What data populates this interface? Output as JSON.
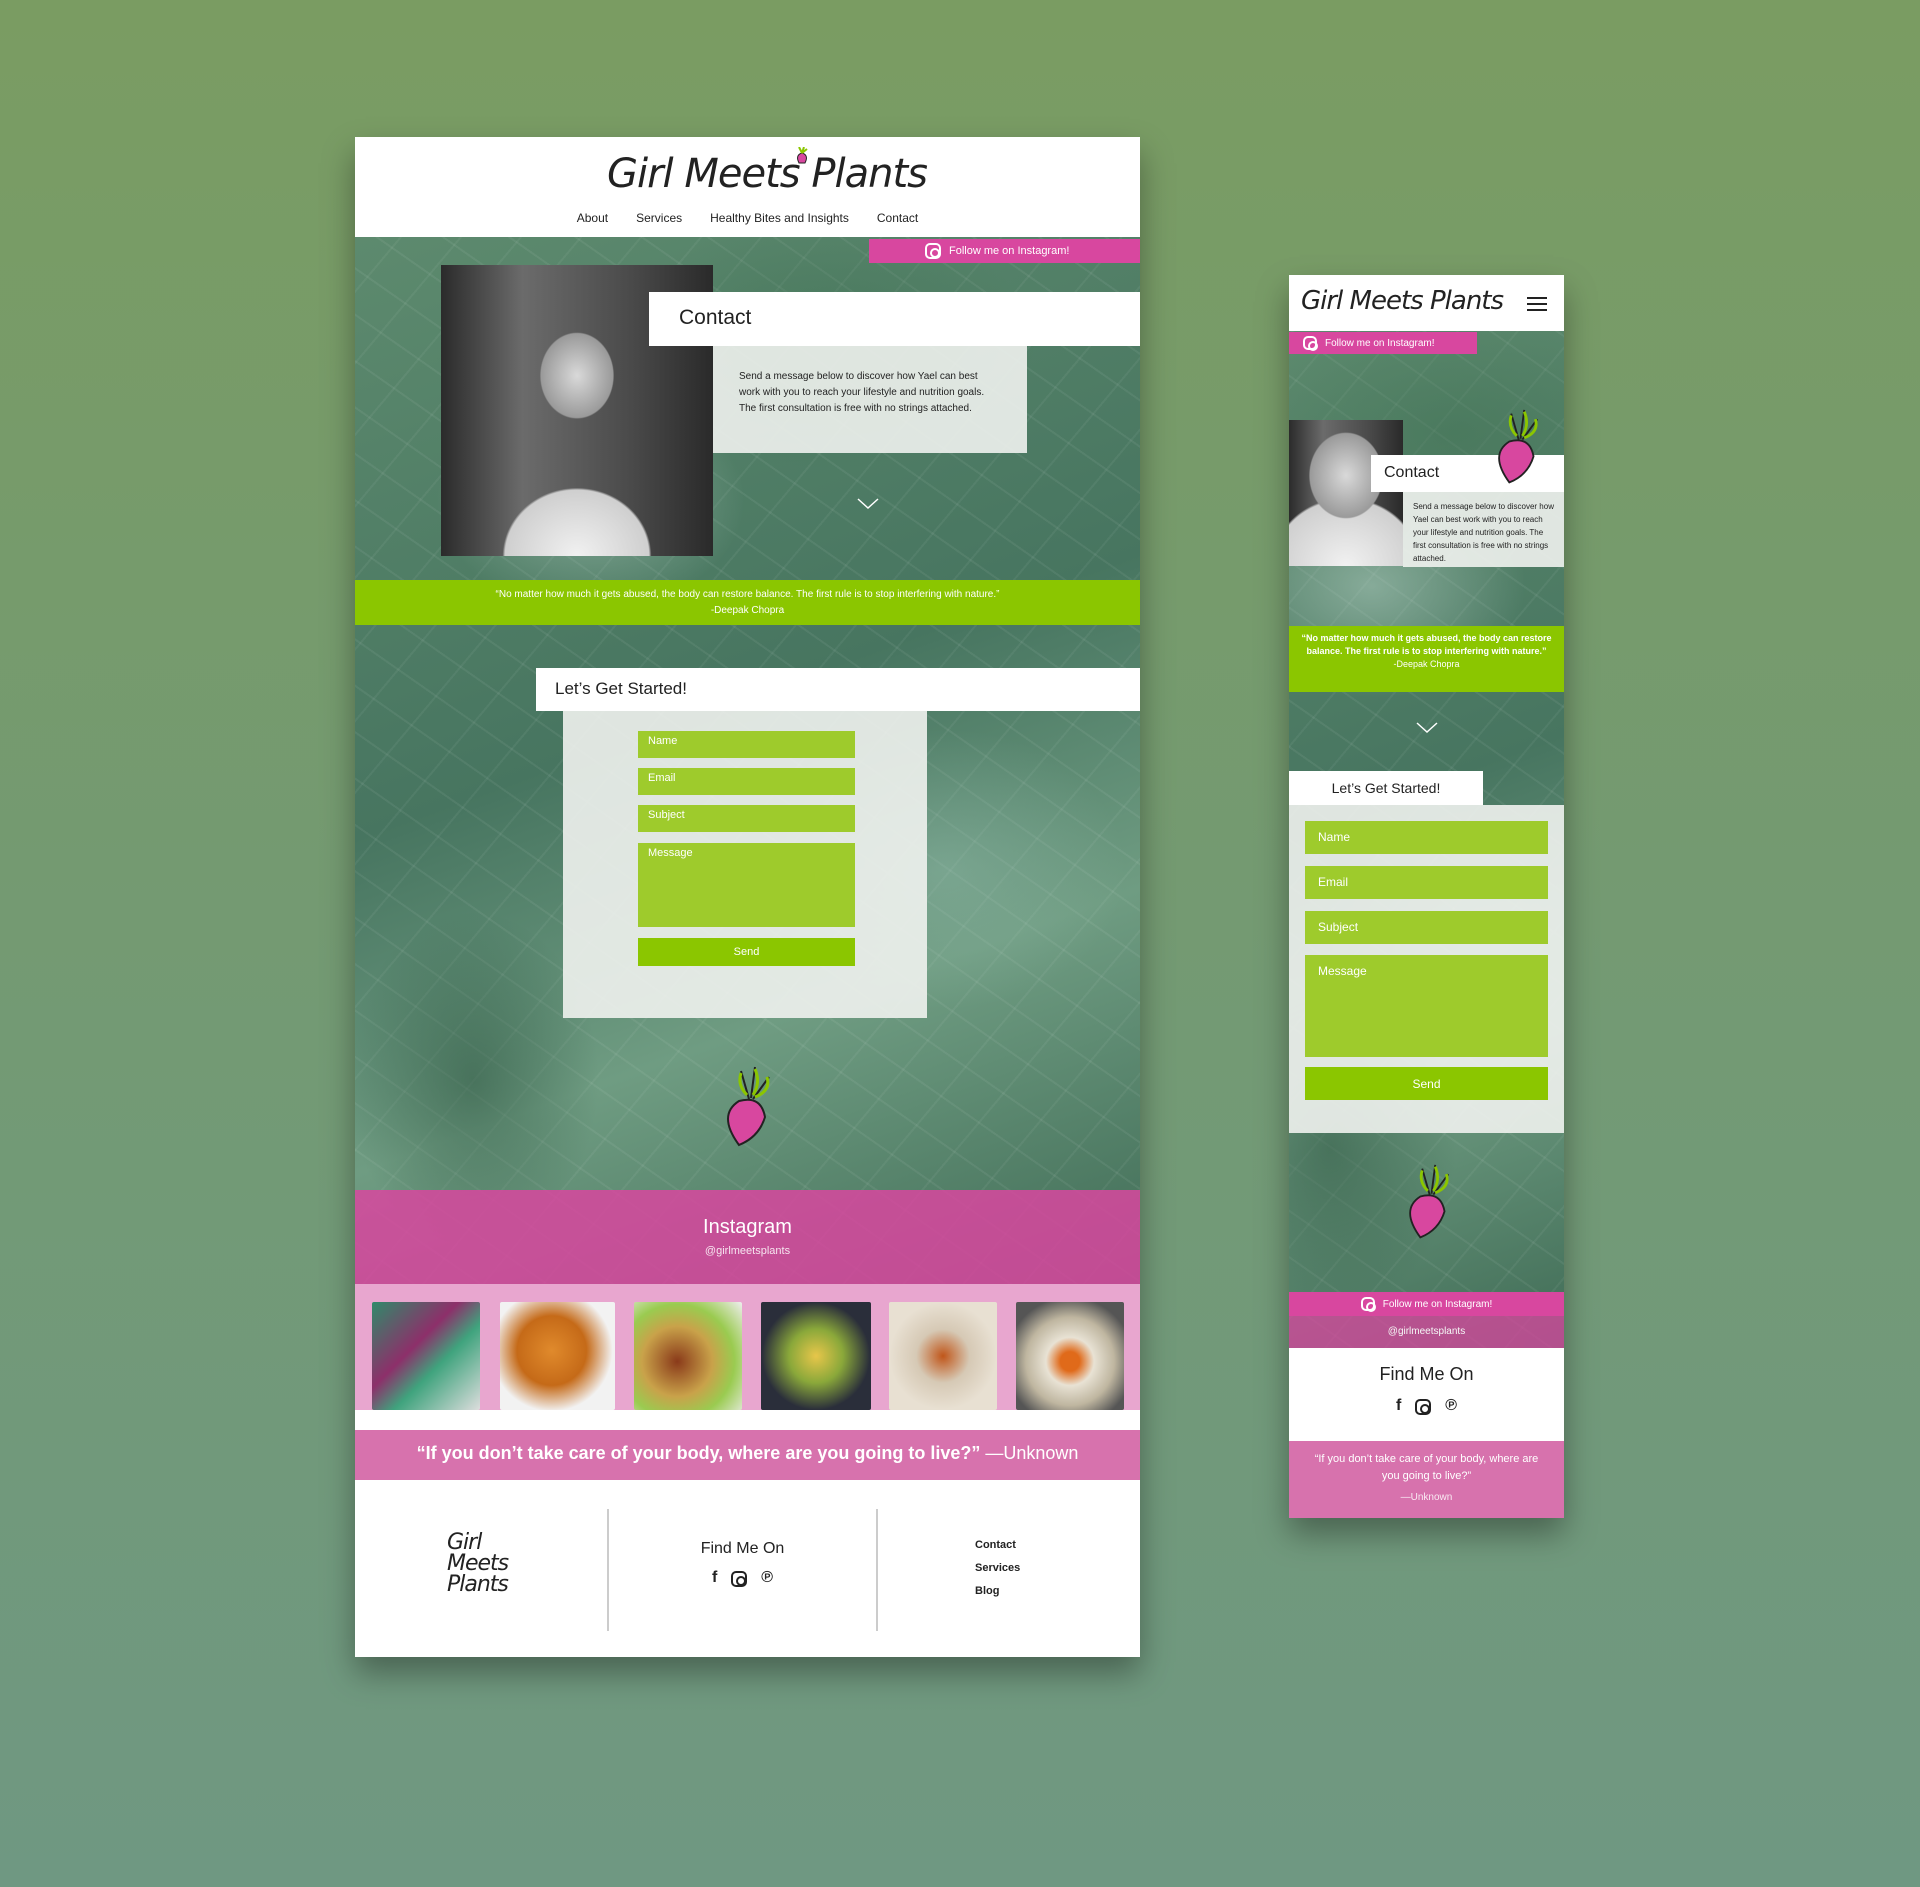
{
  "brand": {
    "name": "Girl Meets Plants",
    "footer_lines": [
      "Girl",
      "Meets",
      "Plants"
    ]
  },
  "nav": {
    "items": [
      "About",
      "Services",
      "Healthy Bites and Insights",
      "Contact"
    ]
  },
  "instagram_bar": {
    "label": "Follow me on Instagram!"
  },
  "contact": {
    "title": "Contact",
    "desc": "Send a message below to discover how Yael can best work with you to reach your lifestyle and nutrition goals. The first consultation is free with no strings attached."
  },
  "quote1": {
    "text": "“No matter how much it gets abused, the body can restore balance. The first rule is to stop interfering with nature.”",
    "author": "-Deepak Chopra"
  },
  "form": {
    "title": "Let’s Get Started!",
    "name": "Name",
    "email": "Email",
    "subject": "Subject",
    "message": "Message",
    "send": "Send"
  },
  "instagram": {
    "title": "Instagram",
    "handle": "@girlmeetsplants"
  },
  "quote2": {
    "text": "“If you don’t take care of your body, where are you going to live?”",
    "author": "—Unknown",
    "mobile_text": "“If you don’t take care of your body, where are you going to live?”",
    "mobile_author": "—Unknown"
  },
  "footer": {
    "find_title": "Find Me On",
    "links": [
      "Contact",
      "Services",
      "Blog"
    ]
  },
  "social": [
    "facebook-icon",
    "instagram-icon",
    "pinterest-icon"
  ],
  "colors": {
    "pink": "#d8479f",
    "green": "#8bc600",
    "light_pink": "#e8a6cf",
    "mid_pink": "#d772ad"
  }
}
